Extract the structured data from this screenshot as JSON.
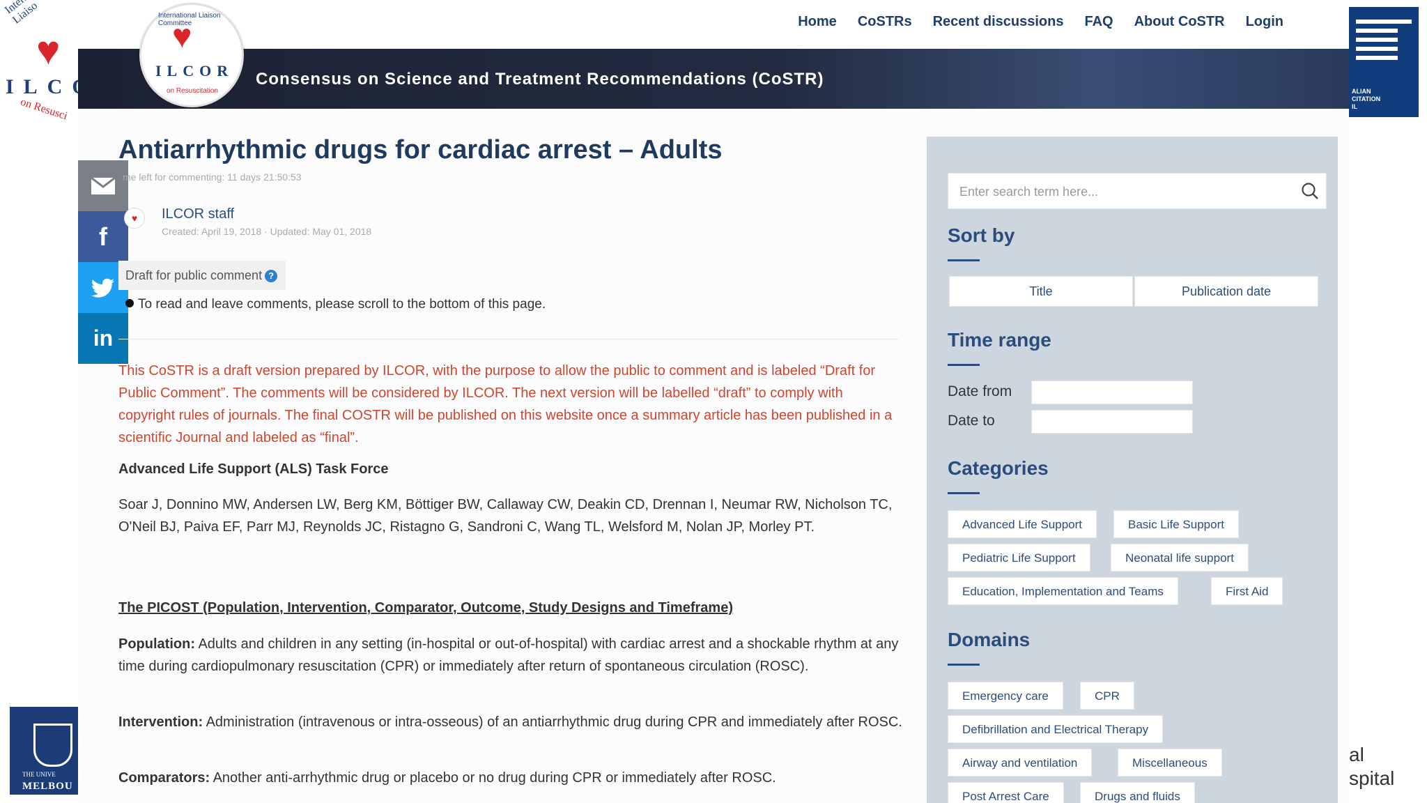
{
  "nav": {
    "items": [
      "Home",
      "CoSTRs",
      "Recent discussions",
      "FAQ",
      "About CoSTR",
      "Login"
    ]
  },
  "banner": {
    "title": "Consensus on Science and Treatment Recommendations (CoSTR)",
    "logo_text": "ILCOR",
    "logo_top": "International Liaison Committee",
    "logo_bottom": "on Resuscitation"
  },
  "slide": {
    "left_logo_text": "ILCO",
    "left_logo_top": "International Liaiso",
    "left_logo_bottom": "on Resusci",
    "right_logo_text": "ALIAN\nCITATION\nIL",
    "bottom_left_top": "THE UNIVE",
    "bottom_left_bottom": "MELBOU",
    "bottom_right_text": "al\nspital"
  },
  "article": {
    "title": "Antiarrhythmic drugs for cardiac arrest – Adults",
    "time_left": "me left for commenting: 11 days 21:50:53",
    "author": "ILCOR staff",
    "meta": "Created: April 19, 2018 · Updated: May 01, 2018",
    "draft_tag": "Draft for public comment",
    "read_note": "To read and leave comments, please scroll to the bottom of this page.",
    "red_note": "This CoSTR is a draft version prepared by ILCOR, with the purpose to allow the public to comment and is labeled “Draft for Public Comment”. The comments will be considered by ILCOR. The next version will be labelled “draft” to comply with copyright rules of journals. The final COSTR will be published on this website once a summary article has been published in a scientific Journal and labeled as “final”.",
    "taskforce": "Advanced Life Support (ALS) Task Force",
    "authors": "Soar J, Donnino MW, Andersen LW, Berg KM, Böttiger BW, Callaway CW, Deakin CD, Drennan I, Neumar RW, Nicholson TC, O'Neil BJ, Paiva EF, Parr MJ, Reynolds JC, Ristagno G, Sandroni C, Wang TL, Welsford M, Nolan JP, Morley PT.",
    "picost_title": "The PICOST (Population, Intervention, Comparator, Outcome, Study Designs and Timeframe)",
    "population_label": "Population:",
    "population_text": " Adults and children in any setting (in-hospital or out-of-hospital) with cardiac arrest and a shockable rhythm at any time during cardiopulmonary resuscitation (CPR) or immediately after return of spontaneous circulation (ROSC).",
    "intervention_label": "Intervention:",
    "intervention_text": " Administration (intravenous or intra-osseous) of an antiarrhythmic drug during CPR and immediately after ROSC.",
    "comparators_label": "Comparators:",
    "comparators_text": " Another anti-arrhythmic drug or placebo or no drug during CPR or immediately after ROSC."
  },
  "share": {
    "facebook": "f",
    "linkedin": "in"
  },
  "sidebar": {
    "search_placeholder": "Enter search term here...",
    "sort_heading": "Sort by",
    "sort_buttons": [
      "Title",
      "Publication date"
    ],
    "time_heading": "Time range",
    "date_from": "Date from",
    "date_to": "Date to",
    "categories_heading": "Categories",
    "categories": [
      "Advanced Life Support",
      "Basic Life Support",
      "Pediatric Life Support",
      "Neonatal life support",
      "Education, Implementation and Teams",
      "First Aid"
    ],
    "domains_heading": "Domains",
    "domains": [
      "Emergency care",
      "CPR",
      "Defibrillation and Electrical Therapy",
      "Airway and ventilation",
      "Miscellaneous",
      "Post Arrest Care",
      "Drugs and fluids"
    ]
  },
  "colors": {
    "accent": "#2b4d7d",
    "draft_red": "#d0442e",
    "banner_dark": "#1c2233"
  }
}
